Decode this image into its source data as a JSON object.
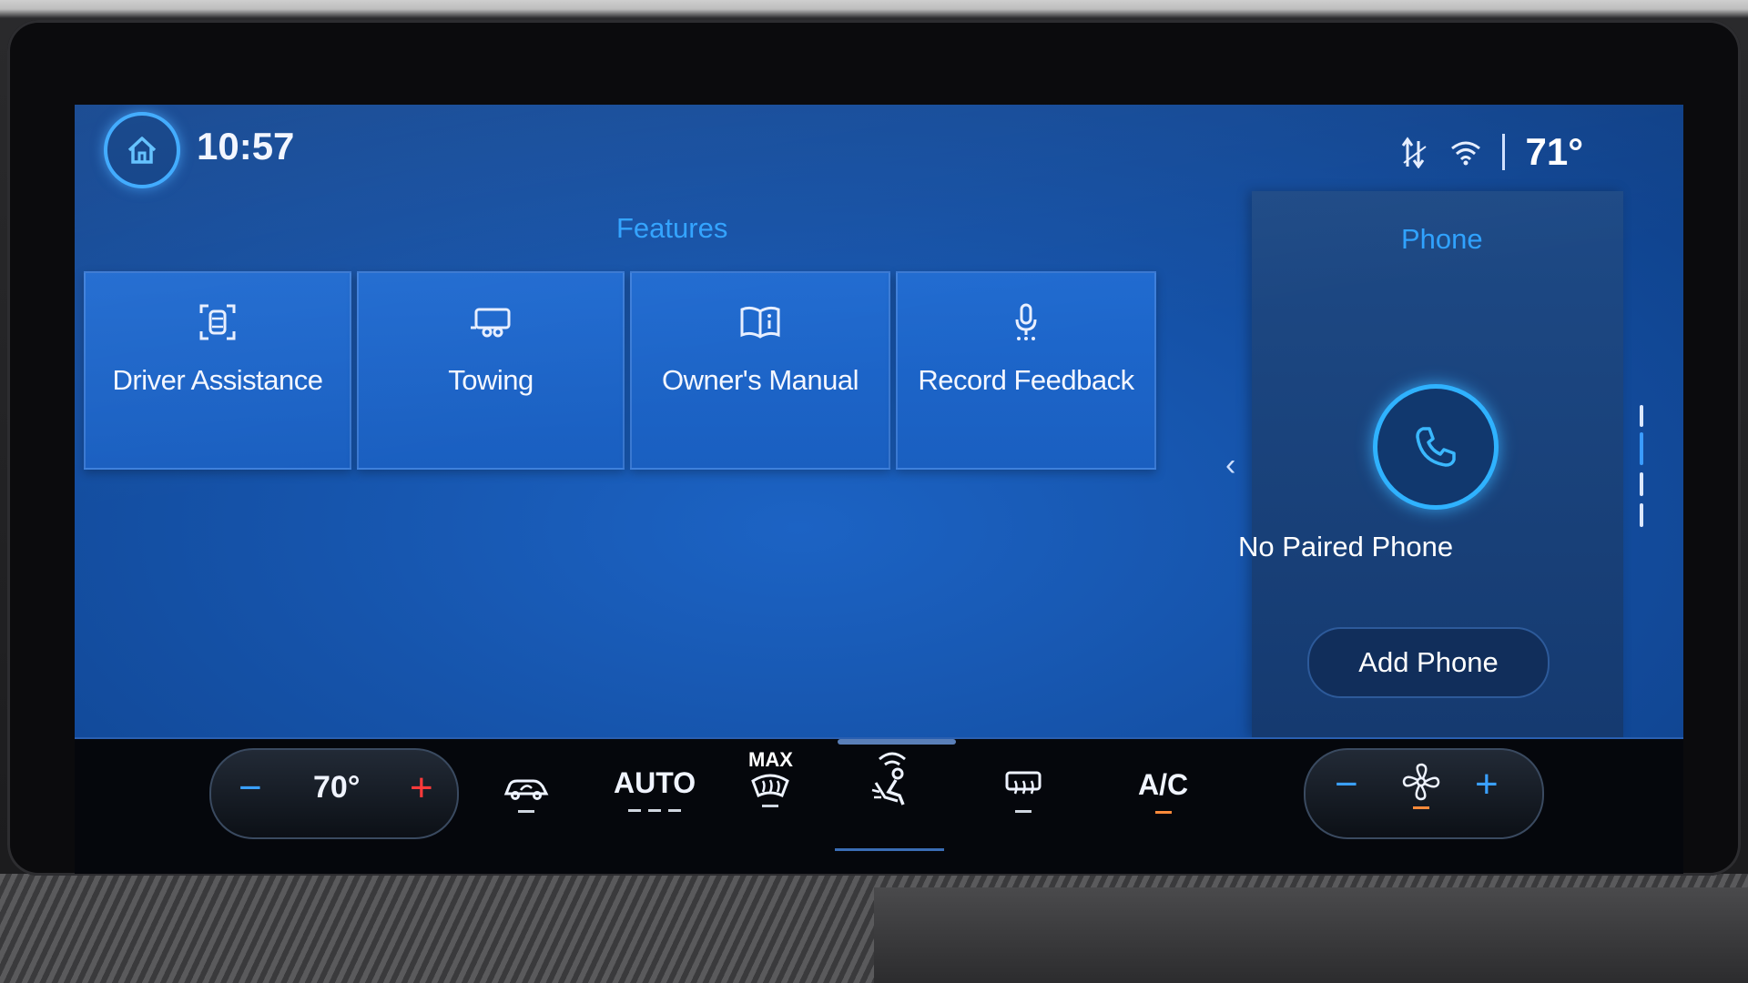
{
  "status_bar": {
    "time": "10:57",
    "outside_temp": "71°",
    "icons": [
      "home-icon",
      "data-transfer-icon",
      "wifi-icon"
    ]
  },
  "features": {
    "title": "Features",
    "tiles": [
      {
        "label": "Driver Assistance",
        "icon": "driver-assist-icon"
      },
      {
        "label": "Towing",
        "icon": "trailer-icon"
      },
      {
        "label": "Owner's Manual",
        "icon": "manual-book-icon"
      },
      {
        "label": "Record Feedback",
        "icon": "microphone-icon"
      }
    ]
  },
  "phone": {
    "title": "Phone",
    "status": "No Paired Phone",
    "add_label": "Add Phone"
  },
  "climate": {
    "set_temp": "70°",
    "auto_label": "AUTO",
    "max_label": "MAX",
    "ac_label": "A/C",
    "minus": "−",
    "plus": "+",
    "colors": {
      "accent_blue": "#3aa0ff",
      "indicator_orange": "#ff8a3a",
      "plus_red": "#ff3a3a"
    }
  }
}
